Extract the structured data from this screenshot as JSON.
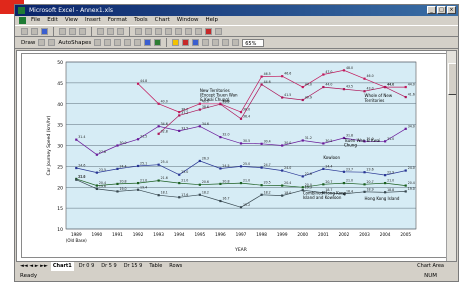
{
  "window": {
    "title": "Microsoft Excel - Annex1.xls",
    "buttons": [
      "_",
      "□",
      "×"
    ]
  },
  "menu": {
    "items": [
      "File",
      "Edit",
      "View",
      "Insert",
      "Format",
      "Tools",
      "Chart",
      "Window",
      "Help"
    ]
  },
  "toolbar2": {
    "draw_label": "Draw",
    "autoshapes_label": "AutoShapes",
    "zoom": "65%"
  },
  "sheet_tabs": [
    "Chart1",
    "Dr 0 9",
    "Dr 5 9",
    "Dr 15 9",
    "Table",
    "Rows"
  ],
  "active_tab": "Chart1",
  "status": {
    "left": "Ready",
    "right": "NUM"
  },
  "chart_name_box": "Chart Area",
  "chart_data": {
    "type": "line",
    "title": "",
    "xlabel": "YEAR",
    "ylabel": "Car Journey Speed (km/hr)",
    "x": [
      "1989",
      "1990",
      "1991",
      "1992",
      "1993",
      "1994",
      "1995",
      "1996",
      "1997",
      "1998",
      "1999",
      "2000",
      "2001",
      "2002",
      "2003",
      "2004",
      "2005"
    ],
    "x_sub": "(Old Base)",
    "ylim": [
      10,
      50
    ],
    "yticks": [
      10,
      15,
      20,
      25,
      30,
      35,
      40,
      45,
      50
    ],
    "grid": true,
    "series": [
      {
        "name": "New Territories (Except Tsuen Wan & Kwai Chung)",
        "color": "#c2185b",
        "values": [
          null,
          null,
          null,
          44.8,
          40.0,
          38.0,
          40.0,
          40.0,
          38.0,
          46.5,
          46.6,
          44.0,
          47.0,
          48.0,
          46.0,
          44.0,
          44.0
        ]
      },
      {
        "name": "Whole of Non-Territories",
        "color": "#ad1457",
        "values": [
          null,
          null,
          null,
          null,
          32.8,
          37.2,
          38.6,
          39.9,
          36.4,
          44.6,
          41.5,
          40.9,
          44.0,
          43.5,
          43.0,
          44.0,
          41.6
        ]
      },
      {
        "name": "Tsuen Wan & Kwai Chung",
        "color": "#6a1b9a",
        "values": [
          31.4,
          27.8,
          30.0,
          31.5,
          34.6,
          33.5,
          34.6,
          32.0,
          30.5,
          30.4,
          30.0,
          31.2,
          30.5,
          31.8,
          31.0,
          31.0,
          34.0
        ]
      },
      {
        "name": "Kowloon",
        "color": "#283593",
        "values": [
          24.6,
          23.5,
          24.4,
          25.1,
          25.4,
          23.0,
          26.3,
          24.5,
          25.0,
          24.7,
          24.0,
          22.6,
          24.4,
          23.7,
          23.6,
          22.9,
          24.0
        ]
      },
      {
        "name": "Combined Hong Kong Island and Kowloon",
        "color": "#1b5e20",
        "values": [
          22.0,
          20.4,
          20.8,
          21.0,
          21.6,
          21.0,
          20.6,
          20.8,
          21.0,
          20.5,
          20.4,
          20.0,
          20.7,
          21.0,
          20.7,
          21.0,
          20.4
        ]
      },
      {
        "name": "Hong Kong Island",
        "color": "#37474f",
        "values": [
          21.8,
          19.6,
          19.0,
          19.4,
          18.1,
          17.6,
          18.2,
          16.7,
          15.2,
          18.2,
          18.0,
          19.3,
          18.7,
          18.4,
          18.9,
          18.8,
          19.0
        ]
      }
    ],
    "annotations": [
      {
        "text": "New Territories (Except Tsuen Wan & Kwai Chung)",
        "series": 0
      },
      {
        "text": "Whole of New Territories",
        "series": 1
      },
      {
        "text": "Tsuen Wan & Kwai Chung",
        "series": 2
      },
      {
        "text": "Kowloon",
        "series": 3
      },
      {
        "text": "Combined Hong Kong Island and Kowloon",
        "series": 4
      },
      {
        "text": "Hong Kong Island",
        "series": 5
      }
    ]
  }
}
